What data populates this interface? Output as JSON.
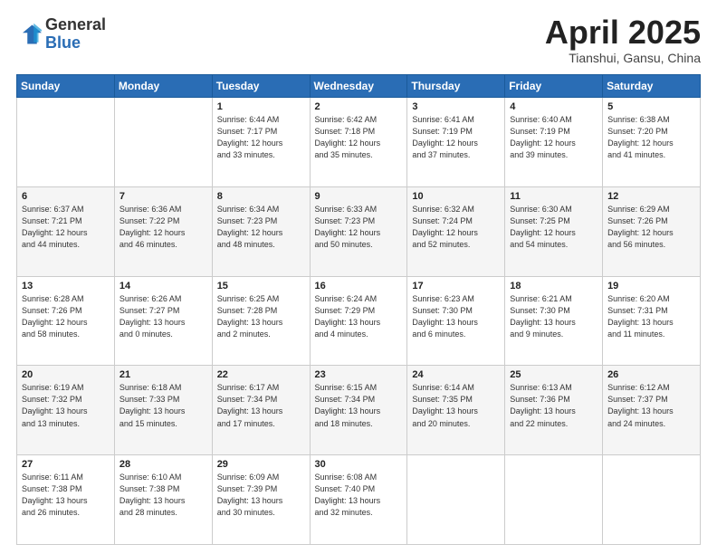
{
  "header": {
    "logo_line1": "General",
    "logo_line2": "Blue",
    "title": "April 2025",
    "location": "Tianshui, Gansu, China"
  },
  "calendar": {
    "days_of_week": [
      "Sunday",
      "Monday",
      "Tuesday",
      "Wednesday",
      "Thursday",
      "Friday",
      "Saturday"
    ],
    "weeks": [
      [
        {
          "day": "",
          "info": ""
        },
        {
          "day": "",
          "info": ""
        },
        {
          "day": "1",
          "info": "Sunrise: 6:44 AM\nSunset: 7:17 PM\nDaylight: 12 hours\nand 33 minutes."
        },
        {
          "day": "2",
          "info": "Sunrise: 6:42 AM\nSunset: 7:18 PM\nDaylight: 12 hours\nand 35 minutes."
        },
        {
          "day": "3",
          "info": "Sunrise: 6:41 AM\nSunset: 7:19 PM\nDaylight: 12 hours\nand 37 minutes."
        },
        {
          "day": "4",
          "info": "Sunrise: 6:40 AM\nSunset: 7:19 PM\nDaylight: 12 hours\nand 39 minutes."
        },
        {
          "day": "5",
          "info": "Sunrise: 6:38 AM\nSunset: 7:20 PM\nDaylight: 12 hours\nand 41 minutes."
        }
      ],
      [
        {
          "day": "6",
          "info": "Sunrise: 6:37 AM\nSunset: 7:21 PM\nDaylight: 12 hours\nand 44 minutes."
        },
        {
          "day": "7",
          "info": "Sunrise: 6:36 AM\nSunset: 7:22 PM\nDaylight: 12 hours\nand 46 minutes."
        },
        {
          "day": "8",
          "info": "Sunrise: 6:34 AM\nSunset: 7:23 PM\nDaylight: 12 hours\nand 48 minutes."
        },
        {
          "day": "9",
          "info": "Sunrise: 6:33 AM\nSunset: 7:23 PM\nDaylight: 12 hours\nand 50 minutes."
        },
        {
          "day": "10",
          "info": "Sunrise: 6:32 AM\nSunset: 7:24 PM\nDaylight: 12 hours\nand 52 minutes."
        },
        {
          "day": "11",
          "info": "Sunrise: 6:30 AM\nSunset: 7:25 PM\nDaylight: 12 hours\nand 54 minutes."
        },
        {
          "day": "12",
          "info": "Sunrise: 6:29 AM\nSunset: 7:26 PM\nDaylight: 12 hours\nand 56 minutes."
        }
      ],
      [
        {
          "day": "13",
          "info": "Sunrise: 6:28 AM\nSunset: 7:26 PM\nDaylight: 12 hours\nand 58 minutes."
        },
        {
          "day": "14",
          "info": "Sunrise: 6:26 AM\nSunset: 7:27 PM\nDaylight: 13 hours\nand 0 minutes."
        },
        {
          "day": "15",
          "info": "Sunrise: 6:25 AM\nSunset: 7:28 PM\nDaylight: 13 hours\nand 2 minutes."
        },
        {
          "day": "16",
          "info": "Sunrise: 6:24 AM\nSunset: 7:29 PM\nDaylight: 13 hours\nand 4 minutes."
        },
        {
          "day": "17",
          "info": "Sunrise: 6:23 AM\nSunset: 7:30 PM\nDaylight: 13 hours\nand 6 minutes."
        },
        {
          "day": "18",
          "info": "Sunrise: 6:21 AM\nSunset: 7:30 PM\nDaylight: 13 hours\nand 9 minutes."
        },
        {
          "day": "19",
          "info": "Sunrise: 6:20 AM\nSunset: 7:31 PM\nDaylight: 13 hours\nand 11 minutes."
        }
      ],
      [
        {
          "day": "20",
          "info": "Sunrise: 6:19 AM\nSunset: 7:32 PM\nDaylight: 13 hours\nand 13 minutes."
        },
        {
          "day": "21",
          "info": "Sunrise: 6:18 AM\nSunset: 7:33 PM\nDaylight: 13 hours\nand 15 minutes."
        },
        {
          "day": "22",
          "info": "Sunrise: 6:17 AM\nSunset: 7:34 PM\nDaylight: 13 hours\nand 17 minutes."
        },
        {
          "day": "23",
          "info": "Sunrise: 6:15 AM\nSunset: 7:34 PM\nDaylight: 13 hours\nand 18 minutes."
        },
        {
          "day": "24",
          "info": "Sunrise: 6:14 AM\nSunset: 7:35 PM\nDaylight: 13 hours\nand 20 minutes."
        },
        {
          "day": "25",
          "info": "Sunrise: 6:13 AM\nSunset: 7:36 PM\nDaylight: 13 hours\nand 22 minutes."
        },
        {
          "day": "26",
          "info": "Sunrise: 6:12 AM\nSunset: 7:37 PM\nDaylight: 13 hours\nand 24 minutes."
        }
      ],
      [
        {
          "day": "27",
          "info": "Sunrise: 6:11 AM\nSunset: 7:38 PM\nDaylight: 13 hours\nand 26 minutes."
        },
        {
          "day": "28",
          "info": "Sunrise: 6:10 AM\nSunset: 7:38 PM\nDaylight: 13 hours\nand 28 minutes."
        },
        {
          "day": "29",
          "info": "Sunrise: 6:09 AM\nSunset: 7:39 PM\nDaylight: 13 hours\nand 30 minutes."
        },
        {
          "day": "30",
          "info": "Sunrise: 6:08 AM\nSunset: 7:40 PM\nDaylight: 13 hours\nand 32 minutes."
        },
        {
          "day": "",
          "info": ""
        },
        {
          "day": "",
          "info": ""
        },
        {
          "day": "",
          "info": ""
        }
      ]
    ]
  }
}
